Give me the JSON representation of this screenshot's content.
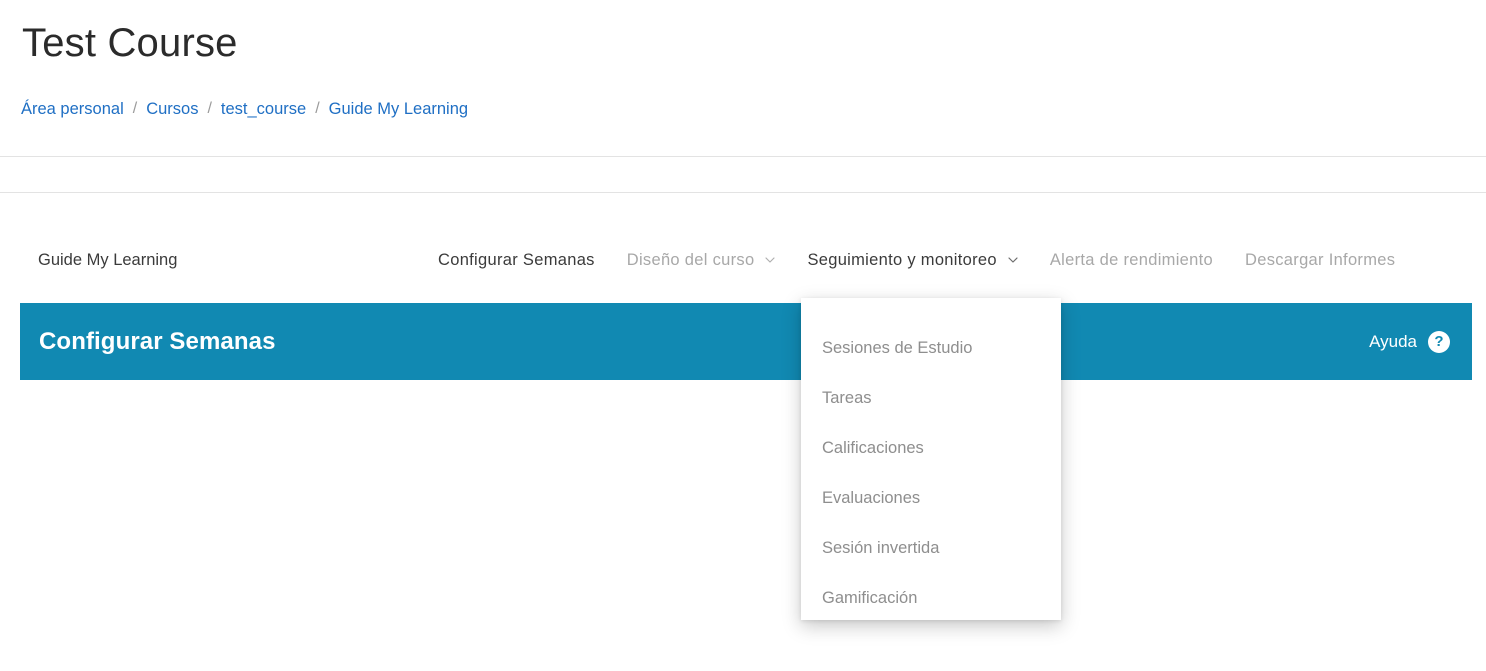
{
  "header": {
    "course_title": "Test Course",
    "breadcrumb": [
      {
        "label": "Área personal"
      },
      {
        "label": "Cursos"
      },
      {
        "label": "test_course"
      },
      {
        "label": "Guide My Learning"
      }
    ],
    "breadcrumb_separator": "/"
  },
  "navbar": {
    "brand": "Guide My Learning",
    "items": [
      {
        "label": "Configurar Semanas",
        "active": true,
        "has_chevron": false
      },
      {
        "label": "Diseño del curso",
        "active": false,
        "has_chevron": true
      },
      {
        "label": "Seguimiento y monitoreo",
        "active": true,
        "has_chevron": true
      },
      {
        "label": "Alerta de rendimiento",
        "active": false,
        "has_chevron": false
      },
      {
        "label": "Descargar Informes",
        "active": false,
        "has_chevron": false
      }
    ]
  },
  "banner": {
    "title": "Configurar Semanas",
    "help_label": "Ayuda",
    "help_icon_glyph": "?",
    "background_color": "#1189b2"
  },
  "dropdown": {
    "parent": "Seguimiento y monitoreo",
    "items": [
      {
        "label": "Sesiones de Estudio"
      },
      {
        "label": "Tareas"
      },
      {
        "label": "Calificaciones"
      },
      {
        "label": "Evaluaciones"
      },
      {
        "label": "Sesión invertida"
      },
      {
        "label": "Gamificación"
      }
    ]
  },
  "colors": {
    "accent_teal": "#1189b2",
    "link_blue": "#1f6fc4",
    "muted_text": "#a8a8a8",
    "dark_text": "#3b3b3b",
    "rule": "#e3e3e3"
  }
}
